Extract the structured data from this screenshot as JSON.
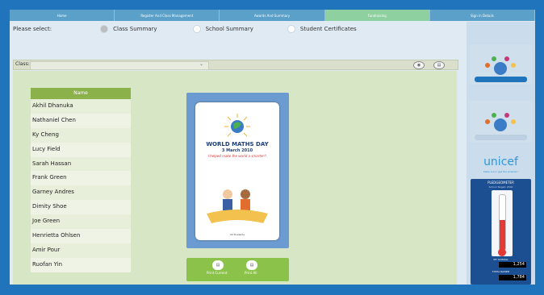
{
  "nav": [
    {
      "label": "Home",
      "active": false
    },
    {
      "label": "Register And Class Management",
      "active": false
    },
    {
      "label": "Awards And Summary",
      "active": false
    },
    {
      "label": "Fundraising",
      "active": true
    },
    {
      "label": "Sign in Details",
      "active": false
    }
  ],
  "select": {
    "prompt": "Please select:",
    "options": [
      "Class Summary",
      "School Summary",
      "Student Certificates"
    ],
    "selected": 0
  },
  "class_bar": {
    "label": "Class:",
    "dropdown_value": "",
    "chevron": "⌄"
  },
  "names": {
    "header": "Name",
    "rows": [
      "Akhil Dhanuka",
      "Nathaniel Chen",
      "Ky Cheng",
      "Lucy Field",
      "Sarah Hassan",
      "Frank Green",
      "Garney Andres",
      "Dimity Shoe",
      "Joe Green",
      "Henrietta Ohlsen",
      "Amir Pour",
      "Ruofan Yin"
    ]
  },
  "certificate": {
    "title": "WORLD MATHS DAY",
    "date": "3 March 2010",
    "tagline": "I helped make the world a smarter!!",
    "footer": "All Students"
  },
  "print": {
    "left_label": "Print Current",
    "right_label": "Print All"
  },
  "sidebar": {
    "unicef": "unicef",
    "unicef_tag": "Make sure I get the smarter!",
    "pedometer": {
      "title": "PLEDGEOMETER",
      "subtitle": "School Target: 2500",
      "fill_fraction": 0.55,
      "caption_top": "MY SCHOOL",
      "value_top": "1,254",
      "caption_bottom": "TOTAL RAISED",
      "value_bottom": "1,784"
    }
  },
  "colors": {
    "accent": "#1f74bb",
    "green": "#8bc24a",
    "header_green": "#8bb24a"
  }
}
